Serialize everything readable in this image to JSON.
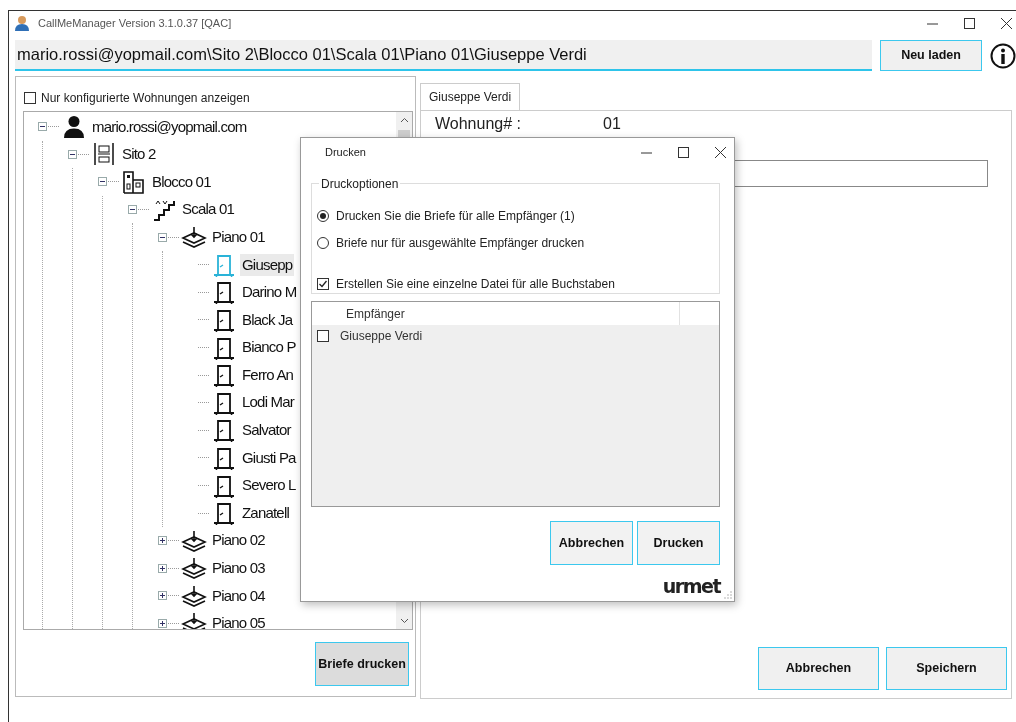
{
  "window": {
    "title": "CallMeManager Version 3.1.0.37 [QAC]"
  },
  "path_bar": {
    "value": "mario.rossi@yopmail.com\\Sito 2\\Blocco 01\\Scala 01\\Piano 01\\Giuseppe Verdi"
  },
  "reload_button": "Neu laden",
  "left_panel": {
    "filter": {
      "label": "Nur konfigurierte Wohnungen anzeigen",
      "checked": false
    },
    "tree": [
      {
        "label": "mario.rossi@yopmail.com",
        "kind": "user",
        "expanded": true,
        "selected": false,
        "children": [
          {
            "label": "Sito 2",
            "kind": "site",
            "expanded": true,
            "selected": false,
            "children": [
              {
                "label": "Blocco 01",
                "kind": "block",
                "expanded": true,
                "selected": false,
                "children": [
                  {
                    "label": "Scala 01",
                    "kind": "stair",
                    "expanded": true,
                    "selected": false,
                    "children": [
                      {
                        "label": "Piano 01",
                        "kind": "floor",
                        "expanded": true,
                        "selected": false,
                        "children": [
                          {
                            "label": "Giusepp",
                            "kind": "apartment",
                            "selected": true
                          },
                          {
                            "label": "Darino M",
                            "kind": "apartment",
                            "selected": false
                          },
                          {
                            "label": "Black Ja",
                            "kind": "apartment",
                            "selected": false
                          },
                          {
                            "label": "Bianco P",
                            "kind": "apartment",
                            "selected": false
                          },
                          {
                            "label": "Ferro An",
                            "kind": "apartment",
                            "selected": false
                          },
                          {
                            "label": "Lodi Mar",
                            "kind": "apartment",
                            "selected": false
                          },
                          {
                            "label": "Salvator",
                            "kind": "apartment",
                            "selected": false
                          },
                          {
                            "label": "Giusti Pa",
                            "kind": "apartment",
                            "selected": false
                          },
                          {
                            "label": "Severo L",
                            "kind": "apartment",
                            "selected": false
                          },
                          {
                            "label": "Zanatell",
                            "kind": "apartment",
                            "selected": false
                          }
                        ]
                      },
                      {
                        "label": "Piano 02",
                        "kind": "floor",
                        "expanded": false,
                        "selected": false
                      },
                      {
                        "label": "Piano 03",
                        "kind": "floor",
                        "expanded": false,
                        "selected": false
                      },
                      {
                        "label": "Piano 04",
                        "kind": "floor",
                        "expanded": false,
                        "selected": false
                      },
                      {
                        "label": "Piano 05",
                        "kind": "floor",
                        "expanded": false,
                        "selected": false
                      }
                    ]
                  }
                ]
              }
            ]
          }
        ]
      }
    ],
    "print_button": "Briefe drucken"
  },
  "detail_panel": {
    "tabs": [
      {
        "label": "Giuseppe Verdi",
        "selected": true
      }
    ],
    "fields": [
      {
        "label": "Wohnung# :",
        "value": "01"
      }
    ],
    "buttons": [
      "Abbrechen",
      "Speichern"
    ]
  },
  "dialog": {
    "title": "Drucken",
    "group_title": "Druckoptionen",
    "options": [
      {
        "label": "Drucken Sie die Briefe für alle Empfänger (1)",
        "selected": true
      },
      {
        "label": "Briefe nur für ausgewählte Empfänger drucken",
        "selected": false
      }
    ],
    "single_file": {
      "label": "Erstellen Sie eine einzelne Datei für alle Buchstaben",
      "checked": true
    },
    "list": {
      "columns": [
        "Empfänger"
      ],
      "rows": [
        {
          "name": "Giuseppe Verdi",
          "checked": false
        }
      ]
    },
    "buttons": [
      "Abbrechen",
      "Drucken"
    ],
    "logo": "urmet"
  }
}
